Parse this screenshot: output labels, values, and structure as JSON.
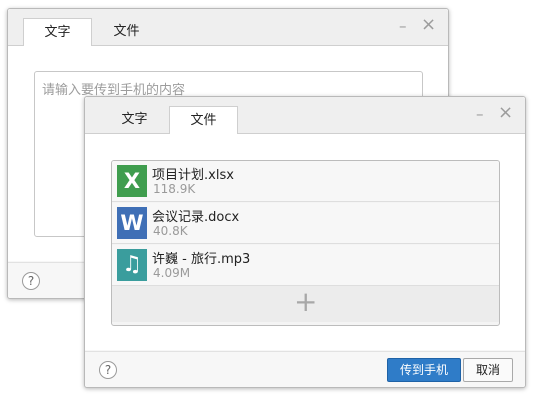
{
  "back_window": {
    "tabs": [
      {
        "label": "文字",
        "active": true
      },
      {
        "label": "文件",
        "active": false
      }
    ],
    "controls": {
      "minimize": "–",
      "close": "×"
    },
    "text_input": {
      "value": "",
      "placeholder": "请输入要传到手机的内容"
    },
    "help": "?"
  },
  "front_window": {
    "tabs": [
      {
        "label": "文字",
        "active": false
      },
      {
        "label": "文件",
        "active": true
      }
    ],
    "controls": {
      "minimize": "–",
      "close": "×"
    },
    "files": [
      {
        "name": "项目计划.xlsx",
        "size": "118.9K",
        "icon": "excel-icon",
        "icon_glyph": "X",
        "icon_color": "#3f9d4e"
      },
      {
        "name": "会议记录.docx",
        "size": "40.8K",
        "icon": "word-icon",
        "icon_glyph": "W",
        "icon_color": "#3f6fb6"
      },
      {
        "name": "许巍 - 旅行.mp3",
        "size": "4.09M",
        "icon": "music-icon",
        "icon_glyph": "♫",
        "icon_color": "#3a9d9d"
      }
    ],
    "add_glyph": "+",
    "help": "?",
    "buttons": {
      "send": "传到手机",
      "cancel": "取消"
    }
  },
  "colors": {
    "primary_button": "#2f7cc8",
    "title_bar": "#efefef"
  }
}
